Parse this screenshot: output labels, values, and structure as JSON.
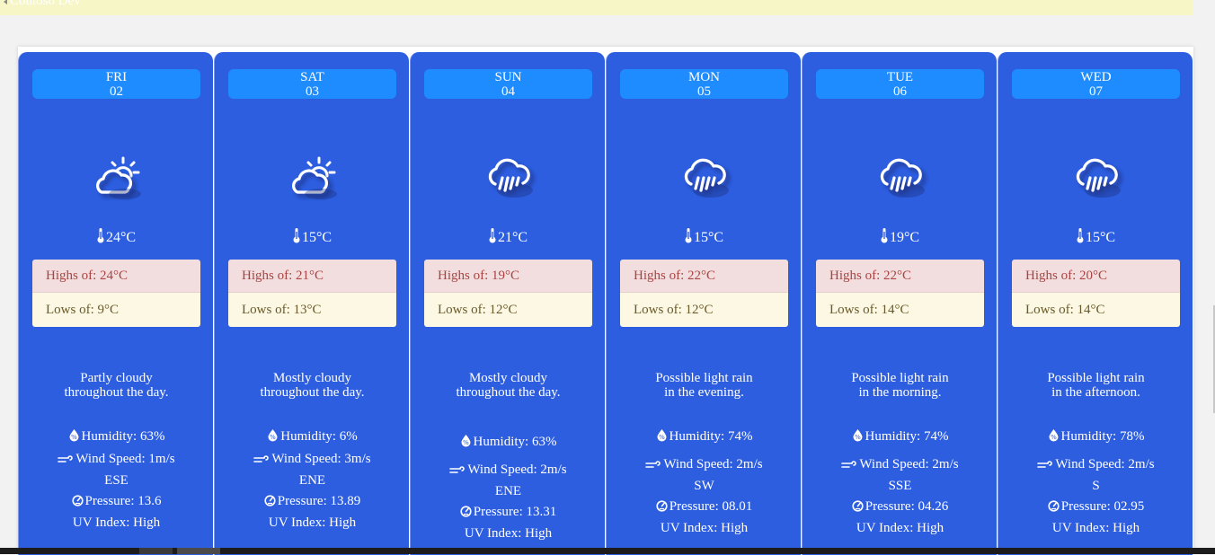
{
  "app": {
    "title": "Contoso Dev"
  },
  "colors": {
    "card_bg": "#2d5ee0",
    "day_pill": "#1e8cff",
    "highs_bg": "#f2dede",
    "highs_text": "#a94442",
    "lows_bg": "#fcf8e3"
  },
  "days": [
    {
      "day": "FRI",
      "date": "02",
      "icon": "partly-cloudy-icon",
      "temp": "24°C",
      "highs": "Highs of: 24°C",
      "lows": "Lows of: 9°C",
      "desc1": "Partly cloudy",
      "desc2": "throughout the day.",
      "humidity": "Humidity: 63%",
      "wind": "Wind Speed: 1m/s",
      "dir": "ESE",
      "pressure": "Pressure: 13.6",
      "uv": "UV Index: High"
    },
    {
      "day": "SAT",
      "date": "03",
      "icon": "partly-cloudy-icon",
      "temp": "15°C",
      "highs": "Highs of: 21°C",
      "lows": "Lows of: 13°C",
      "desc1": "Mostly cloudy",
      "desc2": "throughout the day.",
      "humidity": "Humidity: 6%",
      "wind": "Wind Speed: 3m/s",
      "dir": "ENE",
      "pressure": "Pressure: 13.89",
      "uv": "UV Index: High"
    },
    {
      "day": "SUN",
      "date": "04",
      "icon": "rain-icon",
      "temp": "21°C",
      "highs": "Highs of: 19°C",
      "lows": "Lows of: 12°C",
      "desc1": "Mostly cloudy",
      "desc2": "throughout the day.",
      "humidity": "Humidity: 63%",
      "wind": "Wind Speed: 2m/s",
      "dir": "ENE",
      "pressure": "Pressure: 13.31",
      "uv": "UV Index: High"
    },
    {
      "day": "MON",
      "date": "05",
      "icon": "rain-icon",
      "temp": "15°C",
      "highs": "Highs of: 22°C",
      "lows": "Lows of: 12°C",
      "desc1": "Possible light rain",
      "desc2": "in the evening.",
      "humidity": "Humidity: 74%",
      "wind": "Wind Speed: 2m/s",
      "dir": "SW",
      "pressure": "Pressure: 08.01",
      "uv": "UV Index: High"
    },
    {
      "day": "TUE",
      "date": "06",
      "icon": "rain-icon",
      "temp": "19°C",
      "highs": "Highs of: 22°C",
      "lows": "Lows of: 14°C",
      "desc1": "Possible light rain",
      "desc2": "in the morning.",
      "humidity": "Humidity: 74%",
      "wind": "Wind Speed: 2m/s",
      "dir": "SSE",
      "pressure": "Pressure: 04.26",
      "uv": "UV Index: High"
    },
    {
      "day": "WED",
      "date": "07",
      "icon": "rain-icon",
      "temp": "15°C",
      "highs": "Highs of: 20°C",
      "lows": "Lows of: 14°C",
      "desc1": "Possible light rain",
      "desc2": "in the afternoon.",
      "humidity": "Humidity: 78%",
      "wind": "Wind Speed: 2m/s",
      "dir": "S",
      "pressure": "Pressure: 02.95",
      "uv": "UV Index: High"
    }
  ]
}
